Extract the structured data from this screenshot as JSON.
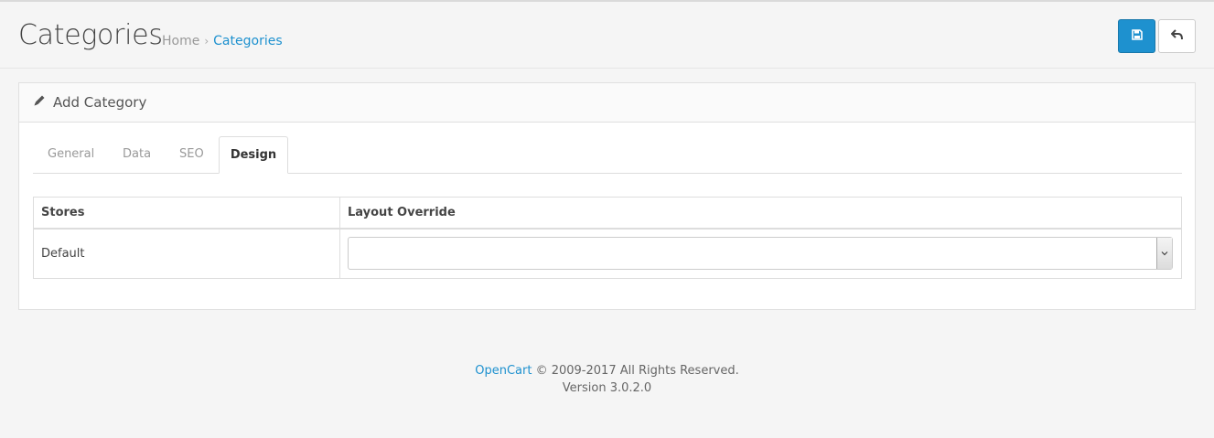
{
  "header": {
    "title": "Categories",
    "breadcrumb": {
      "home": "Home",
      "separator": "›",
      "current": "Categories"
    },
    "buttons": {
      "save_icon": "save-icon",
      "back_icon": "reply-icon"
    }
  },
  "panel": {
    "title": "Add Category",
    "title_icon": "pencil-icon",
    "tabs": [
      {
        "label": "General",
        "active": false
      },
      {
        "label": "Data",
        "active": false
      },
      {
        "label": "SEO",
        "active": false
      },
      {
        "label": "Design",
        "active": true
      }
    ],
    "table": {
      "headers": [
        "Stores",
        "Layout Override"
      ],
      "rows": [
        {
          "store": "Default",
          "layout_override": ""
        }
      ]
    }
  },
  "footer": {
    "brand": "OpenCart",
    "copyright": "© 2009-2017 All Rights Reserved.",
    "version": "Version 3.0.2.0"
  },
  "colors": {
    "accent": "#1e91cf",
    "background": "#f5f5f5"
  }
}
